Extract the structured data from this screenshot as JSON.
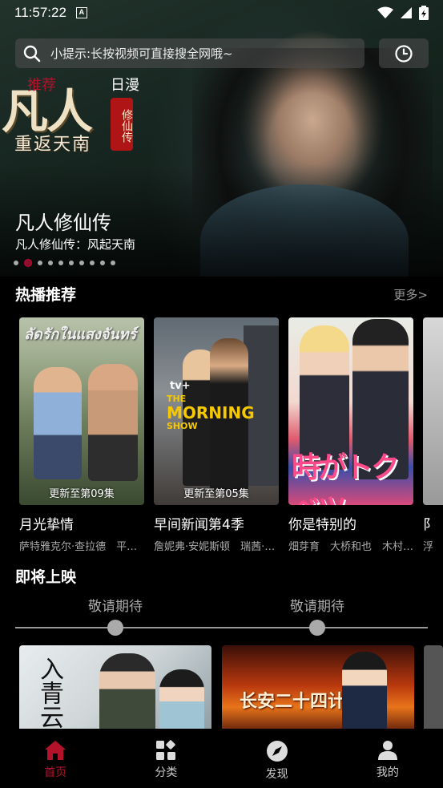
{
  "status_bar": {
    "time": "11:57:22",
    "notif_icon": "A"
  },
  "search": {
    "placeholder": "小提示:长按视频可直接搜全网哦~"
  },
  "top_tabs": [
    "推荐",
    "日漫"
  ],
  "hero": {
    "logo_title": "凡人",
    "logo_subtitle": "重返天南",
    "logo_seal": "修仙传",
    "title": "凡人修仙传",
    "subtitle": "凡人修仙传：风起天南",
    "slide_count": 10,
    "active_slide": 2
  },
  "hot": {
    "title": "热播推荐",
    "more": "更多>",
    "items": [
      {
        "poster_text": "ลัดรักในแสงจันทร์",
        "episode": "更新至第09集",
        "name": "月光挚情",
        "cast": "萨特雅克尔·查拉德　平…"
      },
      {
        "poster_brand": "tv+",
        "poster_line1": "THE",
        "poster_line2": "MORNING",
        "poster_line3": "SHOW",
        "episode": "更新至第05集",
        "name": "早间新闻第4季",
        "cast": "詹妮弗·安妮斯顿　瑞茜·…"
      },
      {
        "poster_text": "時がトクベツ",
        "episode": "",
        "name": "你是特别的",
        "cast": "畑芽育　大桥和也　木村…"
      },
      {
        "name": "阝",
        "cast": "浮"
      }
    ]
  },
  "upcoming": {
    "title": "即将上映",
    "labels": [
      "敬请期待",
      "敬请期待"
    ],
    "items": [
      {
        "poster_text": "入青云"
      },
      {
        "poster_text": "长安二十四计"
      }
    ]
  },
  "nav": [
    {
      "label": "首页",
      "icon": "home-icon",
      "active": true
    },
    {
      "label": "分类",
      "icon": "category-icon",
      "active": false
    },
    {
      "label": "发现",
      "icon": "compass-icon",
      "active": false
    },
    {
      "label": "我的",
      "icon": "user-icon",
      "active": false
    }
  ],
  "colors": {
    "accent": "#b3122a",
    "background": "#000000"
  }
}
